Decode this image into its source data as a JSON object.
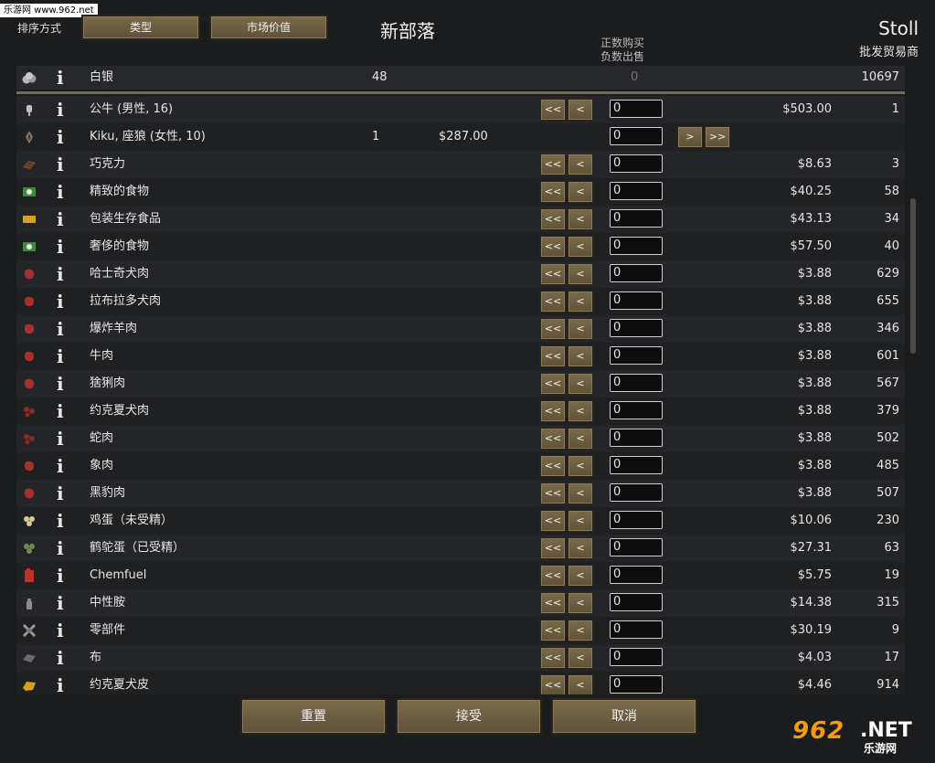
{
  "watermark_top": "乐游网 www.962.net",
  "header": {
    "sort_label": "排序方式",
    "sort_type_btn": "类型",
    "sort_value_btn": "市场价值",
    "title": "新部落",
    "trader_name": "Stoll",
    "trader_type": "批发贸易商",
    "hint_buy": "正数购买",
    "hint_sell": "负数出售"
  },
  "silver": {
    "name": "白银",
    "colony_count": "48",
    "trade_amount": "0",
    "trader_count": "10697"
  },
  "rows": [
    {
      "name": "公牛 (男性, 16)",
      "price": "$503.00",
      "qty": "1",
      "input": "0",
      "icon": "bull-icon",
      "color": "#bdbdbd",
      "buy": true
    },
    {
      "name": "Kiku, 座狼 (女性, 10)",
      "count": "1",
      "price_l": "$287.00",
      "input": "0",
      "icon": "warg-icon",
      "color": "#8a7a66",
      "sell": true
    },
    {
      "name": "巧克力",
      "price": "$8.63",
      "qty": "3",
      "input": "0",
      "icon": "chocolate-icon",
      "color": "#7a4a2a",
      "buy": true
    },
    {
      "name": "精致的食物",
      "price": "$40.25",
      "qty": "58",
      "input": "0",
      "icon": "fine-meal-icon",
      "color": "#3d8a3a",
      "buy": true
    },
    {
      "name": "包装生存食品",
      "price": "$43.13",
      "qty": "34",
      "input": "0",
      "icon": "survival-meal-icon",
      "color": "#d4a21e",
      "buy": true
    },
    {
      "name": "奢侈的食物",
      "price": "$57.50",
      "qty": "40",
      "input": "0",
      "icon": "lavish-meal-icon",
      "color": "#3d8a3a",
      "buy": true
    },
    {
      "name": "哈士奇犬肉",
      "price": "$3.88",
      "qty": "629",
      "input": "0",
      "icon": "meat-icon",
      "color": "#a8302a",
      "buy": true
    },
    {
      "name": "拉布拉多犬肉",
      "price": "$3.88",
      "qty": "655",
      "input": "0",
      "icon": "meat-icon",
      "color": "#a8302a",
      "buy": true
    },
    {
      "name": "爆炸羊肉",
      "price": "$3.88",
      "qty": "346",
      "input": "0",
      "icon": "meat-icon",
      "color": "#a8302a",
      "buy": true
    },
    {
      "name": "牛肉",
      "price": "$3.88",
      "qty": "601",
      "input": "0",
      "icon": "meat-icon",
      "color": "#a8302a",
      "buy": true
    },
    {
      "name": "猞猁肉",
      "price": "$3.88",
      "qty": "567",
      "input": "0",
      "icon": "meat-icon",
      "color": "#a8302a",
      "buy": true
    },
    {
      "name": "约克夏犬肉",
      "price": "$3.88",
      "qty": "379",
      "input": "0",
      "icon": "small-meat-icon",
      "color": "#8a2a24",
      "buy": true
    },
    {
      "name": "蛇肉",
      "price": "$3.88",
      "qty": "502",
      "input": "0",
      "icon": "small-meat-icon",
      "color": "#8a2a24",
      "buy": true
    },
    {
      "name": "象肉",
      "price": "$3.88",
      "qty": "485",
      "input": "0",
      "icon": "meat-icon",
      "color": "#a8302a",
      "buy": true
    },
    {
      "name": "黑豹肉",
      "price": "$3.88",
      "qty": "507",
      "input": "0",
      "icon": "meat-icon",
      "color": "#a8302a",
      "buy": true
    },
    {
      "name": "鸡蛋（未受精）",
      "price": "$10.06",
      "qty": "230",
      "input": "0",
      "icon": "egg-icon",
      "color": "#d8c79a",
      "buy": true
    },
    {
      "name": "鹤鸵蛋（已受精）",
      "price": "$27.31",
      "qty": "63",
      "input": "0",
      "icon": "egg-icon",
      "color": "#6d8a4a",
      "buy": true
    },
    {
      "name": "Chemfuel",
      "price": "$5.75",
      "qty": "19",
      "input": "0",
      "icon": "chemfuel-icon",
      "color": "#c0302a",
      "buy": true
    },
    {
      "name": "中性胺",
      "price": "$14.38",
      "qty": "315",
      "input": "0",
      "icon": "neutroamine-icon",
      "color": "#8a8a8a",
      "buy": true
    },
    {
      "name": "零部件",
      "price": "$30.19",
      "qty": "9",
      "input": "0",
      "icon": "components-icon",
      "color": "#9a9a9a",
      "buy": true
    },
    {
      "name": "布",
      "price": "$4.03",
      "qty": "17",
      "input": "0",
      "icon": "cloth-icon",
      "color": "#6a6a6a",
      "buy": true
    },
    {
      "name": "约克夏犬皮",
      "price": "$4.46",
      "qty": "914",
      "input": "0",
      "icon": "leather-icon",
      "color": "#d4a21e",
      "buy": true
    }
  ],
  "buttons": {
    "dbl_left": "<<",
    "left": "<",
    "right": ">",
    "dbl_right": ">>"
  },
  "footer": {
    "reset": "重置",
    "accept": "接受",
    "cancel": "取消"
  },
  "watermark_br": {
    "num": "962",
    "net": ".NET",
    "cn": "乐游网"
  }
}
